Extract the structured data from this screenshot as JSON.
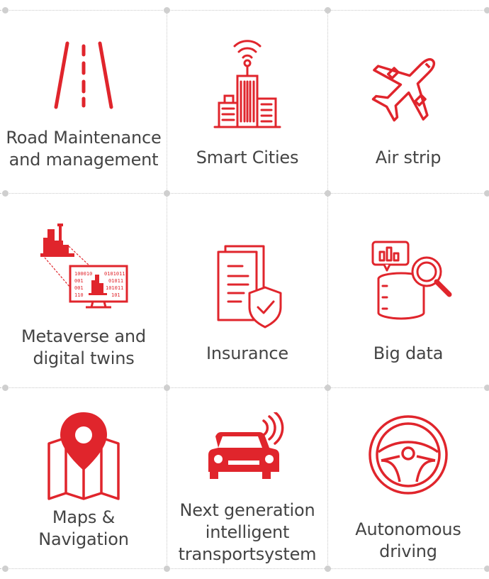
{
  "accent": "#e0252c",
  "tiles": [
    {
      "label_lines": [
        "Road Maintenance",
        "and management"
      ],
      "icon": "road-icon"
    },
    {
      "label_lines": [
        "Smart Cities"
      ],
      "icon": "smart-city-icon"
    },
    {
      "label_lines": [
        "Air strip"
      ],
      "icon": "airplane-icon"
    },
    {
      "label_lines": [
        "Metaverse and",
        "digital twins"
      ],
      "icon": "digital-twin-icon"
    },
    {
      "label_lines": [
        "Insurance"
      ],
      "icon": "insurance-icon"
    },
    {
      "label_lines": [
        "Big data"
      ],
      "icon": "big-data-icon"
    },
    {
      "label_lines": [
        "Maps &",
        "Navigation"
      ],
      "icon": "map-pin-icon"
    },
    {
      "label_lines": [
        "Next generation",
        "intelligent",
        "transportsystem"
      ],
      "icon": "connected-car-icon"
    },
    {
      "label_lines": [
        "Autonomous",
        "driving"
      ],
      "icon": "steering-wheel-icon"
    }
  ],
  "digital_twin_screen_text": [
    "100010",
    "0101011",
    "001",
    "01011",
    "001",
    "101011",
    "110",
    "101"
  ]
}
